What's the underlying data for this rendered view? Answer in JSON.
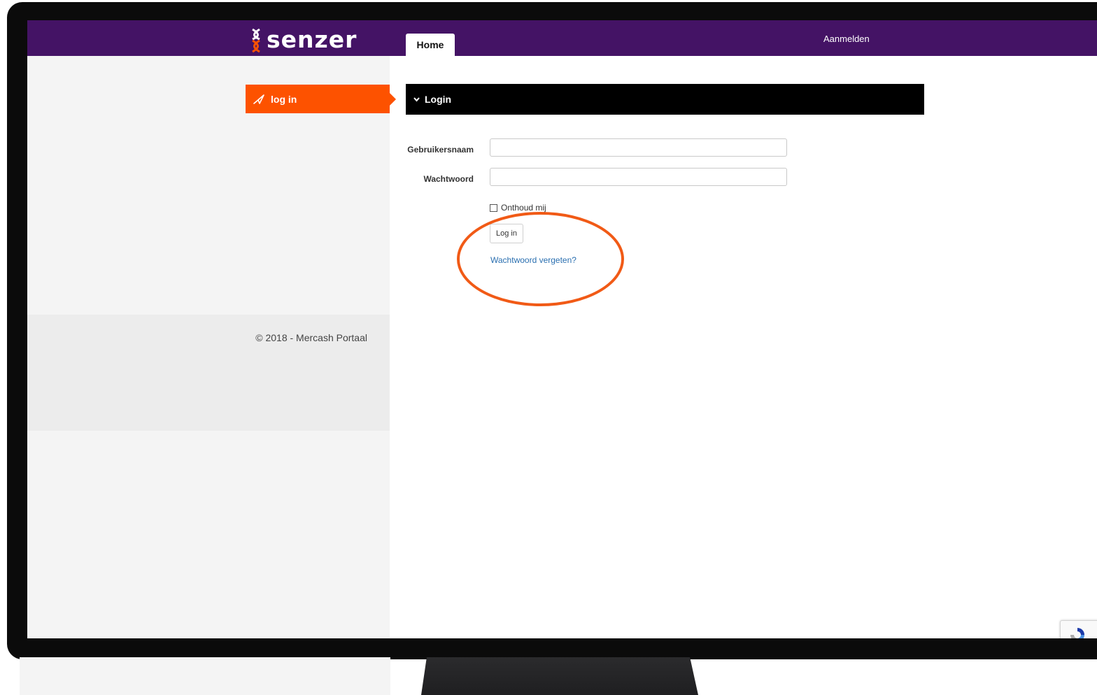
{
  "header": {
    "logo_text": "senzer",
    "tabs": [
      {
        "label": "Home"
      }
    ],
    "register_link": "Aanmelden"
  },
  "sidebar": {
    "items": [
      {
        "label": "log in",
        "icon": "paper-plane-icon"
      }
    ],
    "footer_text": "© 2018 - Mercash Portaal"
  },
  "login_panel": {
    "title": "Login",
    "username_label": "Gebruikersnaam",
    "username_value": "",
    "password_label": "Wachtwoord",
    "password_value": "",
    "remember_label": "Onthoud mij",
    "remember_checked": false,
    "submit_label": "Log in",
    "forgot_link": "Wachtwoord vergeten?"
  },
  "colors": {
    "header_bg": "#441365",
    "accent_orange": "#fd5200",
    "panel_head_bg": "#000000",
    "link_blue": "#2a6fb0",
    "annotation": "#f15a16"
  }
}
